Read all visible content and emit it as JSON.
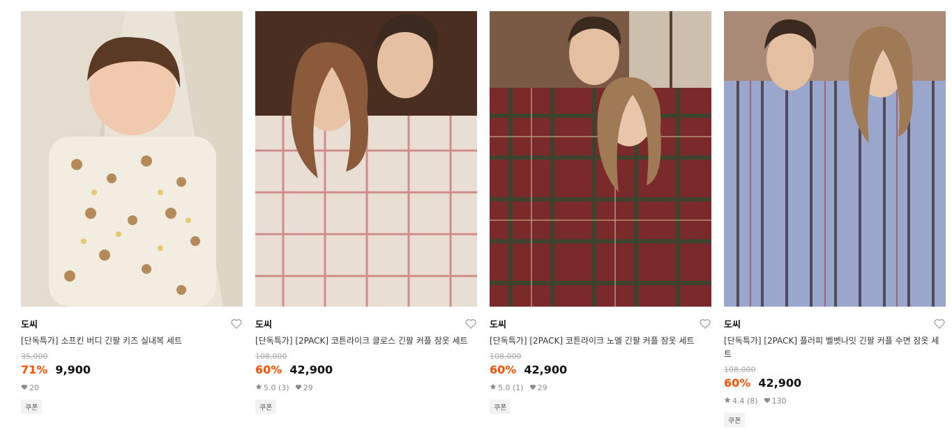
{
  "products": [
    {
      "brand": "도씨",
      "title": "[단독특가] 소프킨 버디 긴팔 키즈 실내복 세트",
      "original_price": "35,000",
      "discount": "71%",
      "price": "9,900",
      "rating": "",
      "review_count": "",
      "likes": "20",
      "coupon": "쿠폰",
      "image_desc": "kids-pajama-photo"
    },
    {
      "brand": "도씨",
      "title": "[단독특가] [2PACK] 코튼라이크 클로스 긴팔 커플 잠옷 세트",
      "original_price": "108,000",
      "discount": "60%",
      "price": "42,900",
      "rating": "5.0",
      "review_count": "(3)",
      "likes": "29",
      "coupon": "쿠폰",
      "image_desc": "couple-pajama-photo"
    },
    {
      "brand": "도씨",
      "title": "[단독특가] [2PACK] 코튼라이크 노엘 긴팔 커플 잠옷 세트",
      "original_price": "108,000",
      "discount": "60%",
      "price": "42,900",
      "rating": "5.0",
      "review_count": "(1)",
      "likes": "29",
      "coupon": "쿠폰",
      "image_desc": "couple-pajama-photo"
    },
    {
      "brand": "도씨",
      "title": "[단독특가] [2PACK] 플러피 벨벳나잇 긴팔 커플 수면 잠옷 세트",
      "original_price": "108,000",
      "discount": "60%",
      "price": "42,900",
      "rating": "4.4",
      "review_count": "(8)",
      "likes": "130",
      "coupon": "쿠폰",
      "image_desc": "couple-pajama-photo"
    }
  ],
  "colors": {
    "discount": "#ff5000",
    "meta": "#8a8a8a",
    "strike": "#a8a8a8"
  },
  "icons": {
    "like": "heart-outline-icon",
    "rating": "star-icon",
    "likes": "heart-filled-icon"
  }
}
